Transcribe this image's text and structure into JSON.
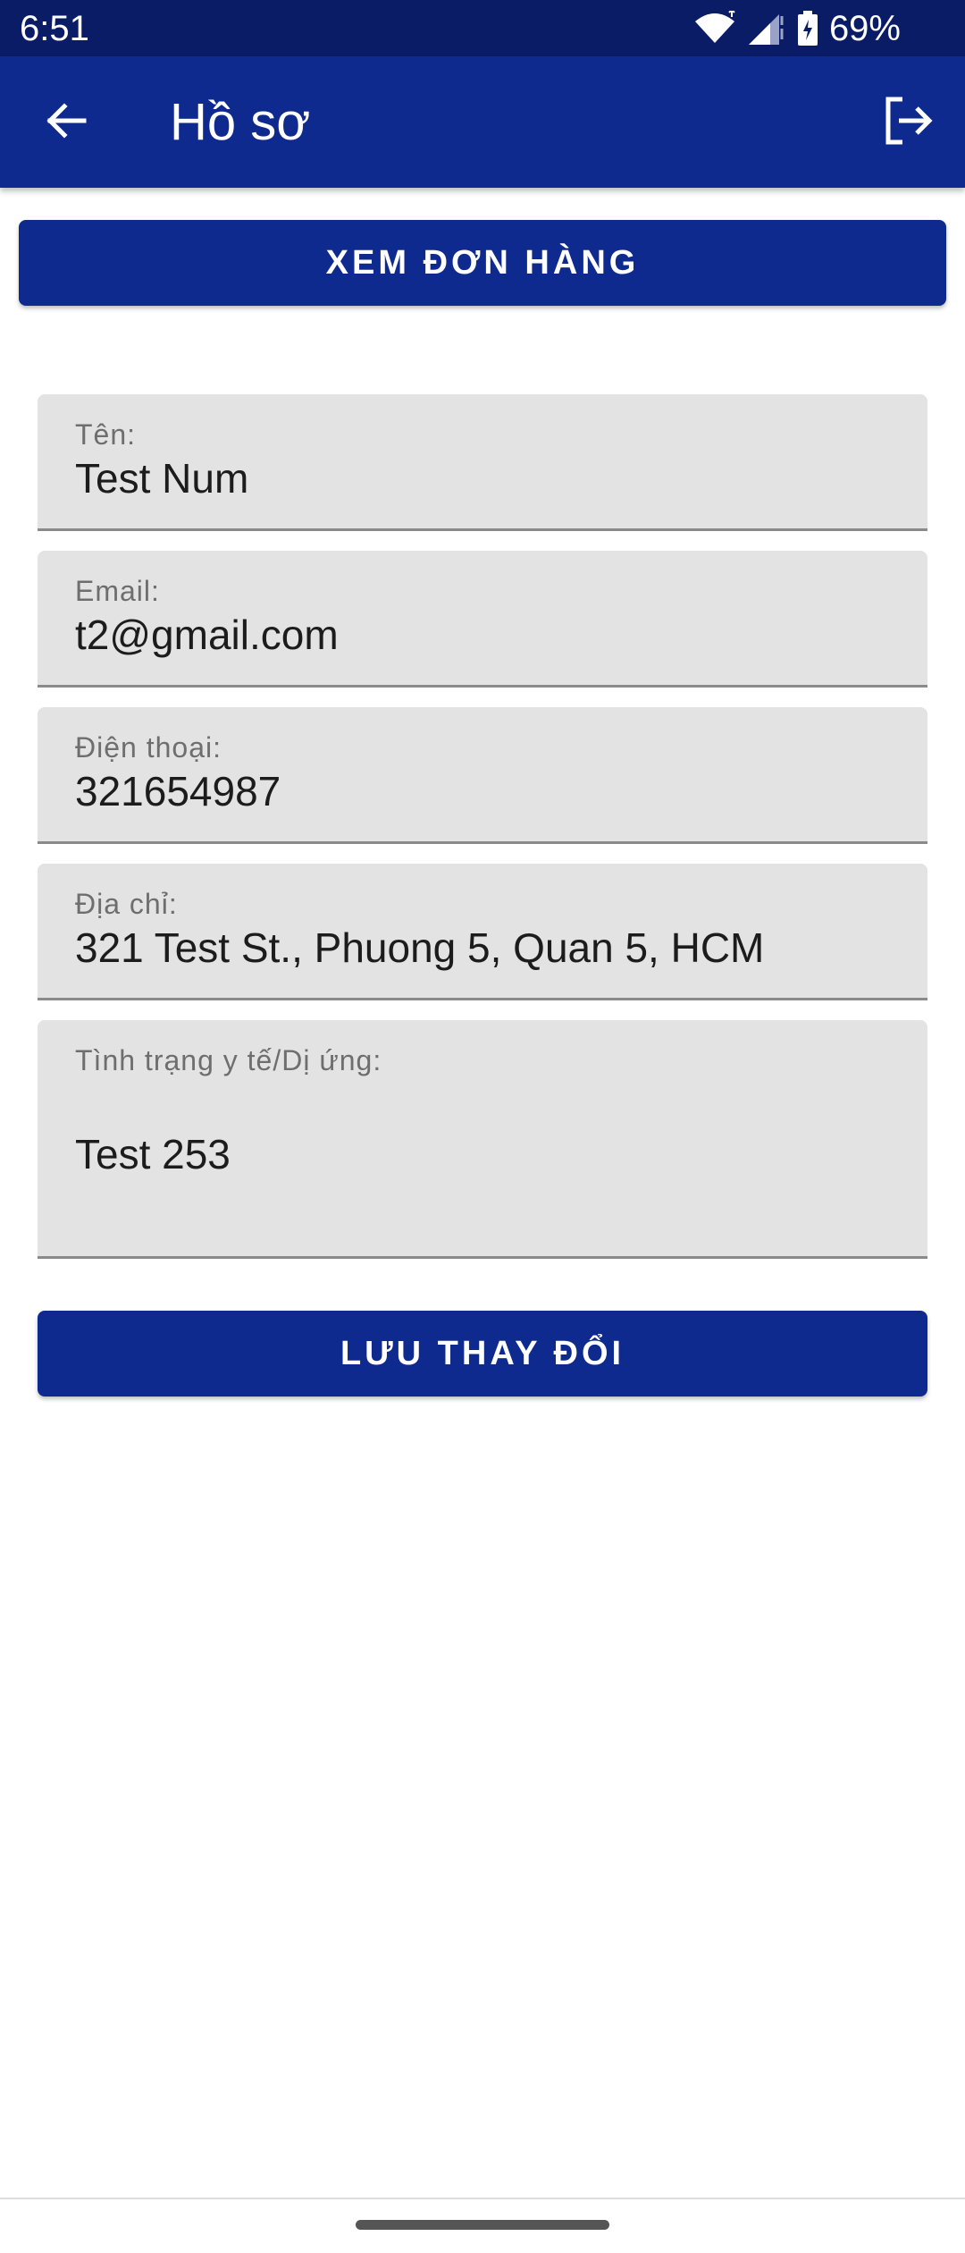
{
  "status_bar": {
    "time": "6:51",
    "battery": "69%",
    "icons": [
      "wifi-icon",
      "signal-icon",
      "battery-icon"
    ]
  },
  "app_bar": {
    "title": "Hồ sơ",
    "back_icon": "arrow-left-icon",
    "logout_icon": "logout-icon"
  },
  "orders_button": {
    "label": "XEM ĐƠN HÀNG"
  },
  "form": {
    "name": {
      "label": "Tên:",
      "value": "Test Num"
    },
    "email": {
      "label": "Email:",
      "value": "t2@gmail.com"
    },
    "phone": {
      "label": "Điện thoại:",
      "value": "321654987"
    },
    "address": {
      "label": "Địa chỉ:",
      "value": "321 Test St., Phuong 5, Quan 5, HCM"
    },
    "medical": {
      "label": "Tình trạng y tế/Dị ứng:",
      "value": "Test 253"
    }
  },
  "save_button": {
    "label": "LƯU THAY ĐỔI"
  },
  "colors": {
    "primary": "#0f2a8f",
    "status_bar": "#0b1c66",
    "field_bg": "#e3e3e3"
  }
}
